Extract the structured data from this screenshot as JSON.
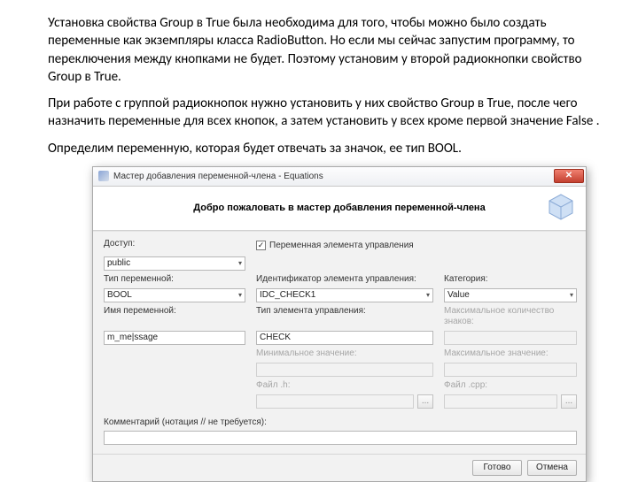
{
  "paras": {
    "p1": "Установка свойства Group в True была необходима для того, чтобы можно было создать переменные как экземпляры класса RadioButton. Но если мы сейчас запустим программу, то переключения между кнопками не будет. Поэтому установим у второй радиокнопки свойство Group в True.",
    "p2": "При работе с группой радиокнопок нужно установить у них свойство Group в True, после чего назначить переменные для всех кнопок, а затем установить у всех кроме первой значение False .",
    "p3": "Определим переменную, которая будет отвечать за значок, ее тип BOOL."
  },
  "dialog": {
    "title": "Мастер добавления переменной-члена - Equations",
    "header": "Добро пожаловать в мастер добавления переменной-члена",
    "labels": {
      "access": "Доступ:",
      "varType": "Тип переменной:",
      "varName": "Имя переменной:",
      "ctrlVar": "Переменная элемента управления",
      "ctrlId": "Идентификатор элемента управления:",
      "category": "Категория:",
      "ctrlType": "Тип элемента управления:",
      "maxChars": "Максимальное количество знаков:",
      "minVal": "Минимальное значение:",
      "maxVal": "Максимальное значение:",
      "fileH": "Файл .h:",
      "fileCpp": "Файл .cpp:",
      "comment": "Комментарий (нотация // не требуется):",
      "browse": "..."
    },
    "values": {
      "access": "public",
      "varType": "BOOL",
      "varName": "m_me|ssage",
      "ctrlId": "IDC_CHECK1",
      "category": "Value",
      "ctrlType": "CHECK",
      "checkMark": "✓"
    },
    "buttons": {
      "finish": "Готово",
      "cancel": "Отмена"
    },
    "close": "✕"
  }
}
